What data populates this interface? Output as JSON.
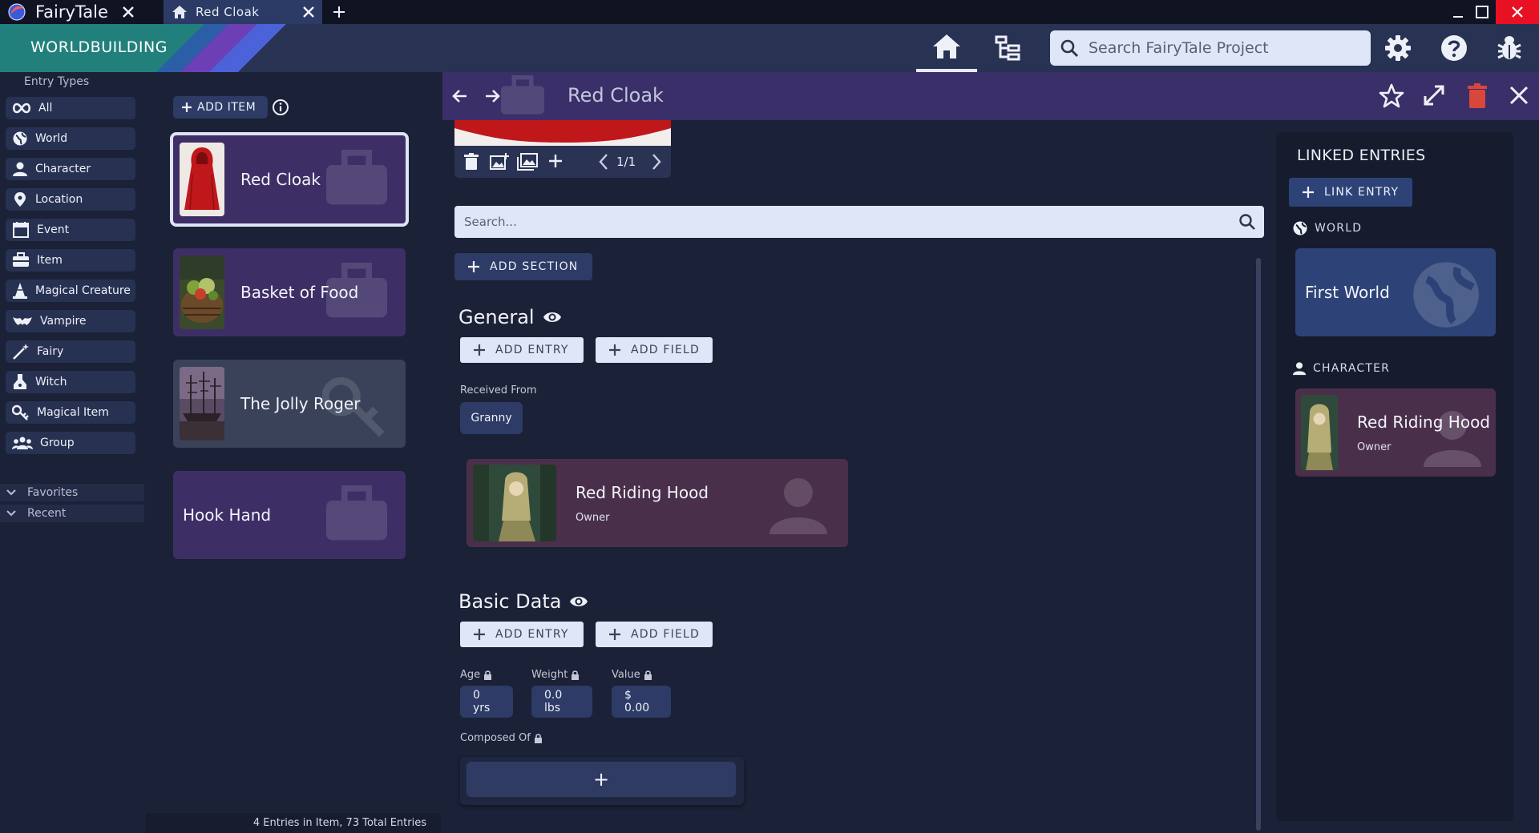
{
  "titlebar": {
    "app_name": "FairyTale",
    "tab_label": "Red Cloak"
  },
  "header": {
    "brand": "WORLDBUILDING",
    "search_placeholder": "Search FairyTale Project"
  },
  "sidebar": {
    "heading": "Entry Types",
    "types": [
      {
        "label": "All",
        "icon": "infinity-icon"
      },
      {
        "label": "World",
        "icon": "globe-icon"
      },
      {
        "label": "Character",
        "icon": "person-icon"
      },
      {
        "label": "Location",
        "icon": "map-pin-icon"
      },
      {
        "label": "Event",
        "icon": "calendar-icon"
      },
      {
        "label": "Item",
        "icon": "briefcase-icon"
      },
      {
        "label": "Magical Creature",
        "icon": "wizard-hat-icon"
      },
      {
        "label": "Vampire",
        "icon": "bat-icon"
      },
      {
        "label": "Fairy",
        "icon": "magic-wand-icon"
      },
      {
        "label": "Witch",
        "icon": "potion-icon"
      },
      {
        "label": "Magical Item",
        "icon": "key-icon"
      },
      {
        "label": "Group",
        "icon": "group-icon"
      }
    ],
    "favorites": "Favorites",
    "recent": "Recent"
  },
  "list": {
    "add_item": "ADD ITEM",
    "entries": [
      {
        "name": "Red Cloak",
        "selected": true
      },
      {
        "name": "Basket of Food"
      },
      {
        "name": "The Jolly Roger"
      },
      {
        "name": "Hook Hand"
      }
    ],
    "status": "4 Entries in Item, 73 Total Entries"
  },
  "detail": {
    "title": "Red Cloak",
    "image_pager": "1/1",
    "search_placeholder": "Search...",
    "add_section": "ADD SECTION",
    "add_entry": "ADD ENTRY",
    "add_field": "ADD FIELD",
    "general": {
      "title": "General",
      "received_from_label": "Received From",
      "received_from_value": "Granny",
      "linked_card": {
        "name": "Red Riding Hood",
        "role": "Owner"
      }
    },
    "basic": {
      "title": "Basic Data",
      "age_label": "Age",
      "age_value": "0 yrs",
      "weight_label": "Weight",
      "weight_value": "0.0 lbs",
      "value_label": "Value",
      "value_value": "$ 0.00",
      "composed_label": "Composed Of",
      "composed_add": "+"
    }
  },
  "linked": {
    "title": "LINKED ENTRIES",
    "link_entry": "LINK ENTRY",
    "world_heading": "WORLD",
    "world_card": "First World",
    "character_heading": "CHARACTER",
    "character_card": {
      "name": "Red Riding Hood",
      "role": "Owner"
    }
  },
  "colors": {
    "accent": "#2e3b66",
    "header": "#283253",
    "item_card": "#3d2f66",
    "character_card": "#4a2f4b",
    "world_card": "#2d4378",
    "delete": "#d9463a"
  }
}
